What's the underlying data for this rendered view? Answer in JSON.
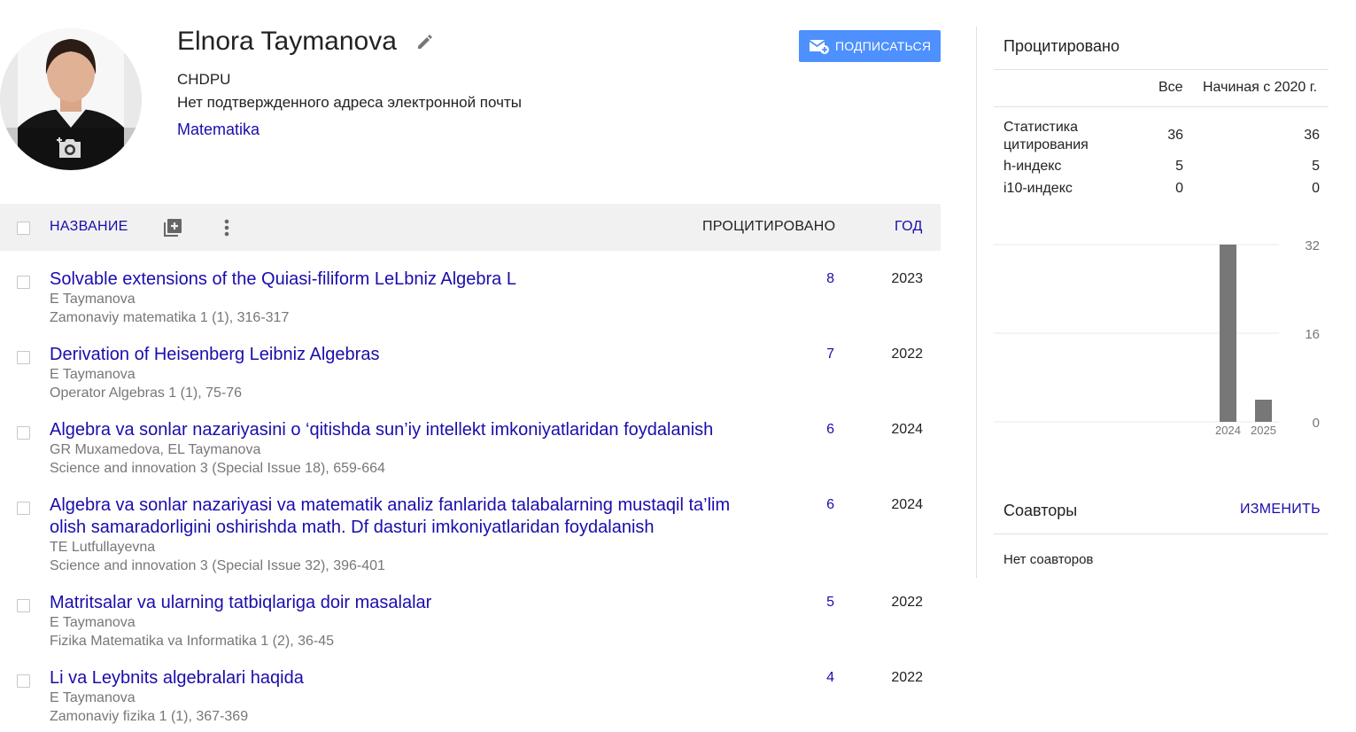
{
  "profile": {
    "name": "Elnora Taymanova",
    "affiliation": "CHDPU",
    "email_status": "Нет подтвержденного адреса электронной почты",
    "interest": "Matematika",
    "follow_label": "ПОДПИСАТЬСЯ"
  },
  "table": {
    "title_header": "НАЗВАНИЕ",
    "cited_header": "ПРОЦИТИРОВАНО",
    "year_header": "ГОД",
    "rows": [
      {
        "title": "Solvable extensions of the Quiasi-filiform LeLbniz Algebra L",
        "authors": "E Taymanova",
        "venue": "Zamonaviy matematika 1 (1), 316-317",
        "cited": "8",
        "year": "2023"
      },
      {
        "title": "Derivation of Heisenberg Leibniz Algebras",
        "authors": "E Taymanova",
        "venue": "Operator Algebras 1 (1), 75-76",
        "cited": "7",
        "year": "2022"
      },
      {
        "title": "Algebra va sonlar nazariyasini o ‘qitishda sun’iy intellekt imkoniyatlaridan foydalanish",
        "authors": "GR Muxamedova, EL Taymanova",
        "venue": "Science and innovation 3 (Special Issue 18), 659-664",
        "cited": "6",
        "year": "2024"
      },
      {
        "title": "Algebra va sonlar nazariyasi va matematik analiz fanlarida talabalarning mustaqil ta’lim olish samaradorligini oshirishda math. Df dasturi imkoniyatlaridan foydalanish",
        "authors": "TE Lutfullayevna",
        "venue": "Science and innovation 3 (Special Issue 32), 396-401",
        "cited": "6",
        "year": "2024"
      },
      {
        "title": "Matritsalar va ularning tatbiqlariga doir masalalar",
        "authors": "E Taymanova",
        "venue": "Fizika Matematika va Informatika 1 (2), 36-45",
        "cited": "5",
        "year": "2022"
      },
      {
        "title": "Li va Leybnits algebralari haqida",
        "authors": "E Taymanova",
        "venue": "Zamonaviy fizika 1 (1), 367-369",
        "cited": "4",
        "year": "2022"
      }
    ]
  },
  "citations": {
    "title": "Процитировано",
    "col_all": "Все",
    "col_since": "Начиная с 2020 г.",
    "stats": [
      {
        "label": "Статистика цитирования",
        "all": "36",
        "since": "36"
      },
      {
        "label": "h-индекс",
        "all": "5",
        "since": "5"
      },
      {
        "label": "i10-индекс",
        "all": "0",
        "since": "0"
      }
    ]
  },
  "chart_data": {
    "type": "bar",
    "categories": [
      "2024",
      "2025"
    ],
    "values": [
      32,
      4
    ],
    "y_ticks": [
      "32",
      "16",
      "0"
    ],
    "ylim": [
      0,
      32
    ],
    "bar_color": "#777777"
  },
  "coauthors": {
    "title": "Соавторы",
    "edit_label": "ИЗМЕНИТЬ",
    "empty_text": "Нет соавторов"
  },
  "colors": {
    "link": "#1a0dab",
    "button": "#4d90fe"
  }
}
